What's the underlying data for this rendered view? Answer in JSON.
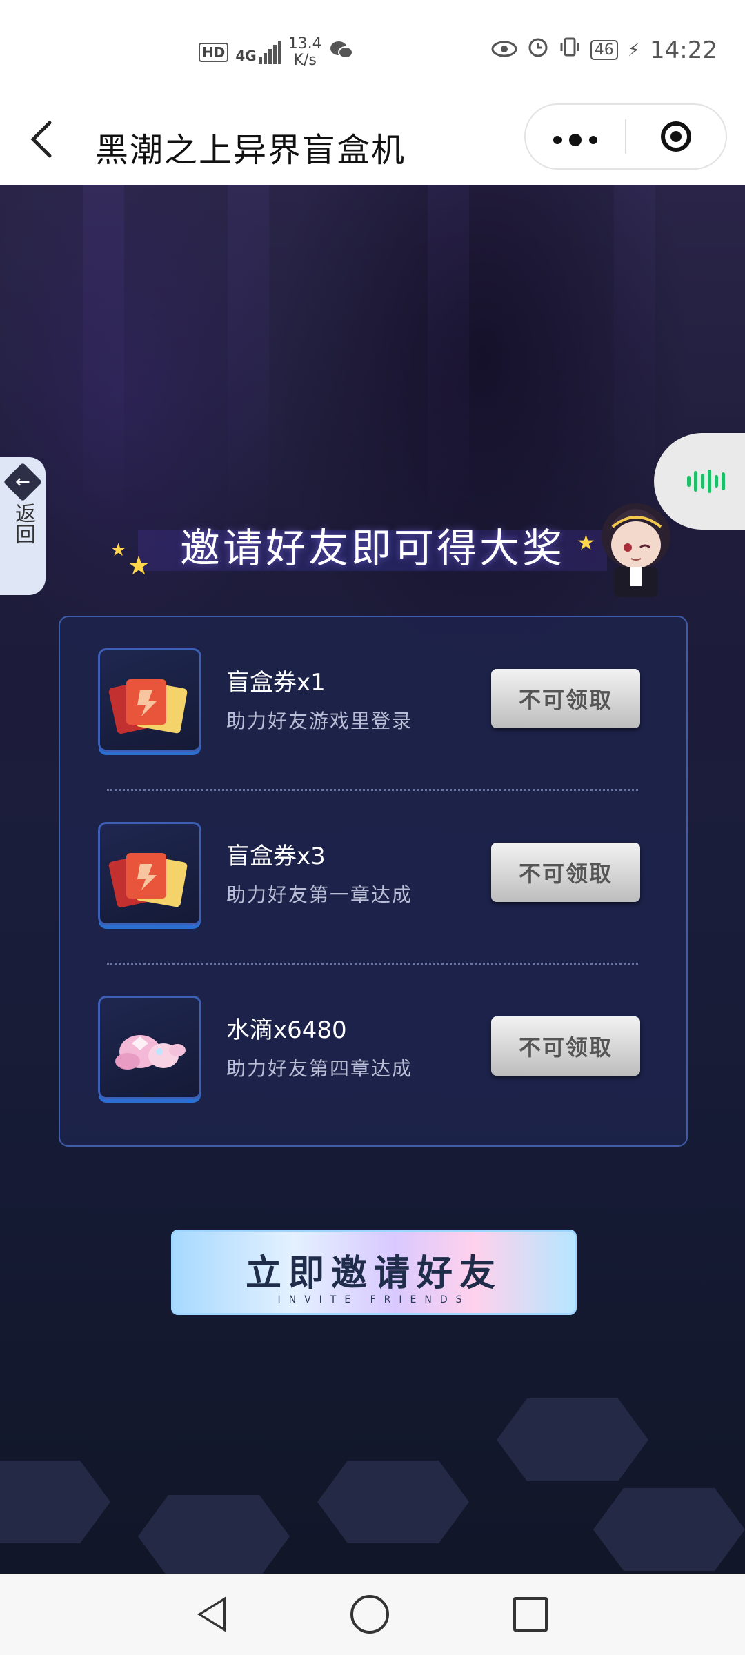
{
  "status_bar": {
    "hd": "HD",
    "network": "4G",
    "speed_value": "13.4",
    "speed_unit": "K/s",
    "battery": "46",
    "time": "14:22"
  },
  "titlebar": {
    "back_icon": "chevron-left-icon",
    "title": "黑潮之上异界盲盒机",
    "more_icon": "more-dots-icon",
    "close_icon": "target-icon"
  },
  "side": {
    "return_label": "返回",
    "return_icon": "arrow-left-icon",
    "voice_icon": "voice-wave-icon"
  },
  "headline": "邀请好友即可得大奖",
  "rewards": [
    {
      "name": "盲盒券x1",
      "desc": "助力好友游戏里登录",
      "button": "不可领取",
      "icon": "ticket-icon"
    },
    {
      "name": "盲盒券x3",
      "desc": "助力好友第一章达成",
      "button": "不可领取",
      "icon": "ticket-icon"
    },
    {
      "name": "水滴x6480",
      "desc": "助力好友第四章达成",
      "button": "不可领取",
      "icon": "crystal-icon"
    }
  ],
  "invite": {
    "label": "立即邀请好友",
    "sub": "INVITE FRIENDS"
  },
  "colors": {
    "accent_green": "#1fbf6a",
    "panel_border": "#3e5ca8",
    "star": "#ffd54a"
  }
}
